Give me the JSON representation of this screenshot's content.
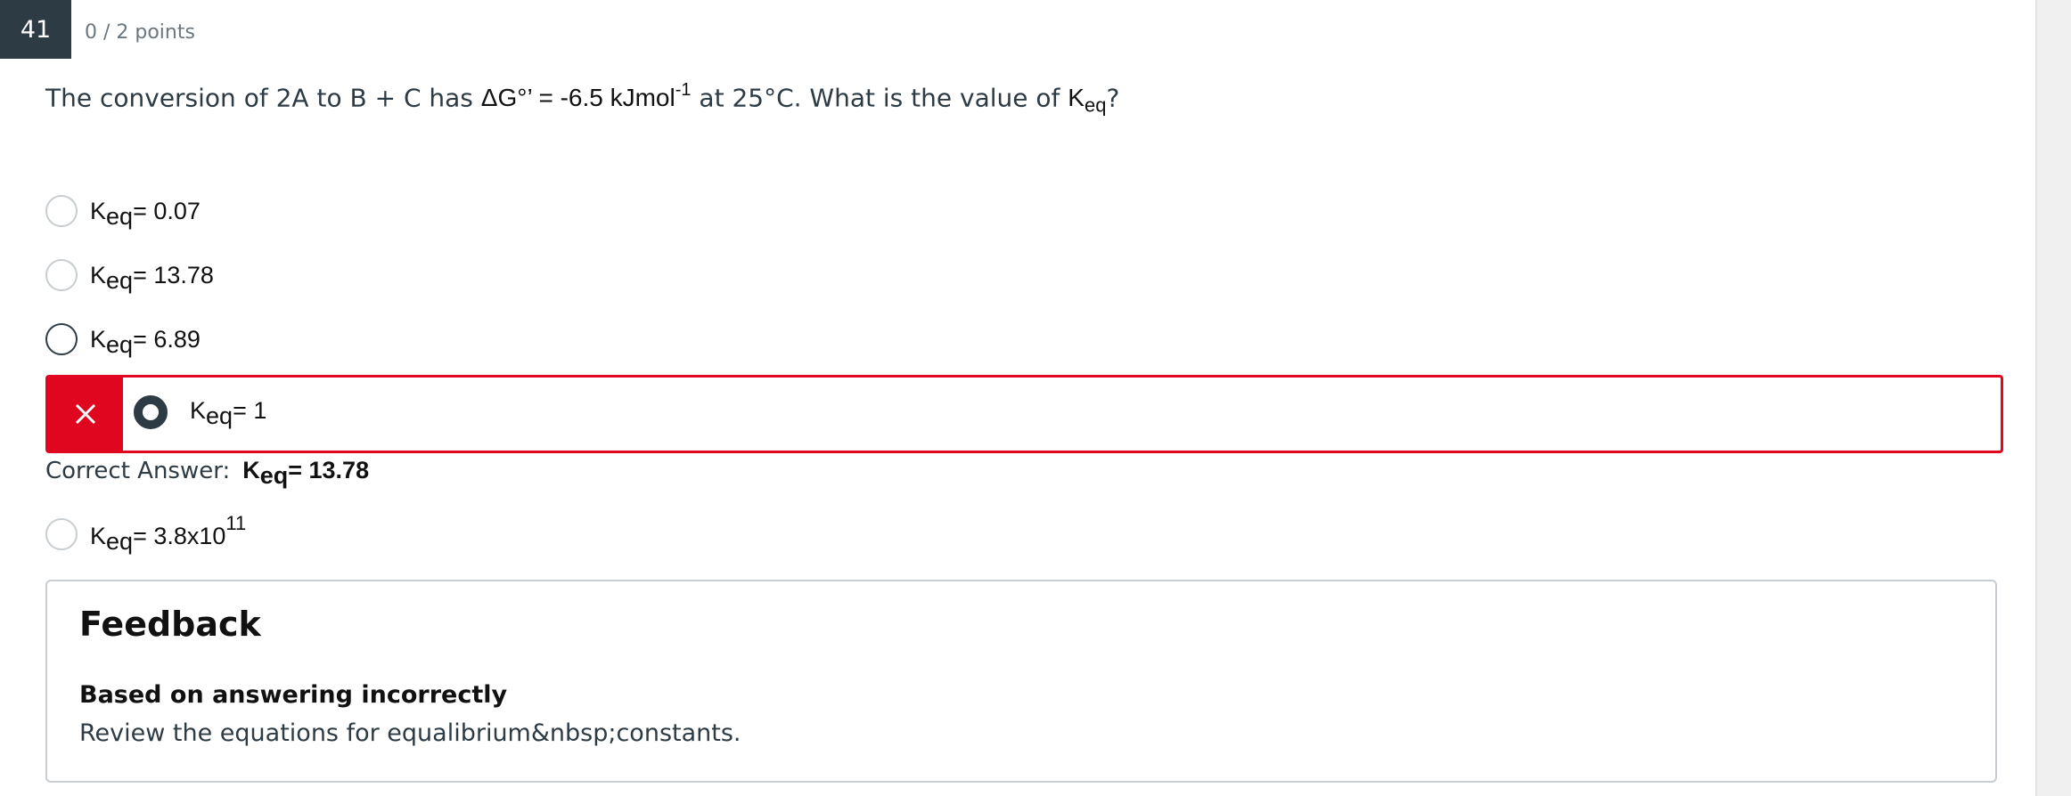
{
  "question_header": {
    "number": "41",
    "points": "0 / 2 points"
  },
  "question": {
    "prefix": "The conversion of 2A to B + C has ",
    "delta_g": "ΔG°’ = -6.5 kJmol",
    "delta_g_exp": "-1",
    "middle": " at 25°C.  What is the value of ",
    "k": "K",
    "k_sub": "eq",
    "end": "?"
  },
  "choices": [
    {
      "k": "K",
      "sub": "eq",
      "text": "= 0.07",
      "sup": ""
    },
    {
      "k": "K",
      "sub": "eq",
      "text": "= 13.78",
      "sup": ""
    },
    {
      "k": "K",
      "sub": "eq",
      "text": "= 6.89",
      "sup": ""
    },
    {
      "k": "K",
      "sub": "eq",
      "text": "= 1",
      "sup": "",
      "selected": true,
      "incorrect": true
    },
    {
      "k": "K",
      "sub": "eq",
      "text": "= 3.8x10",
      "sup": "11"
    }
  ],
  "correct_answer": {
    "label": "Correct Answer:",
    "k": "K",
    "sub": "eq",
    "text": "= 13.78"
  },
  "feedback": {
    "title": "Feedback",
    "subtitle": "Based on answering incorrectly",
    "text": "Review the equations for equalibrium&nbsp;constants."
  },
  "colors": {
    "incorrect": "#e0061f",
    "header_bg": "#2d3b45"
  },
  "icons": {
    "incorrect_marker": "close-icon"
  }
}
